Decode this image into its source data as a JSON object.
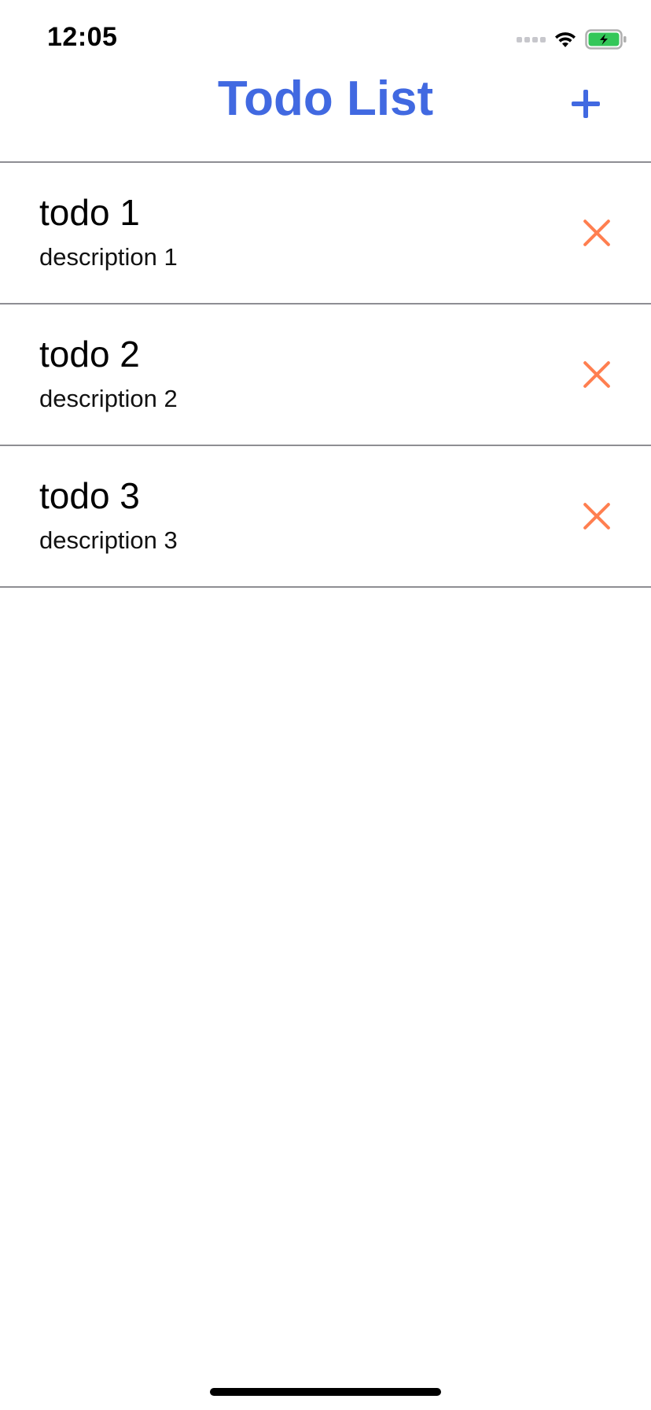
{
  "status_bar": {
    "time": "12:05",
    "icons": [
      "cellular-signal-icon",
      "wifi-icon",
      "battery-charging-icon"
    ],
    "battery_color": "#34c759"
  },
  "header": {
    "title": "Todo List",
    "add_icon": "plus-icon",
    "accent_color": "#4169e1"
  },
  "todos": [
    {
      "title": "todo 1",
      "description": "description 1",
      "delete_icon": "close-icon"
    },
    {
      "title": "todo 2",
      "description": "description 2",
      "delete_icon": "close-icon"
    },
    {
      "title": "todo 3",
      "description": "description 3",
      "delete_icon": "close-icon"
    }
  ],
  "colors": {
    "delete": "#ff7f50",
    "divider": "#8e8e93"
  }
}
